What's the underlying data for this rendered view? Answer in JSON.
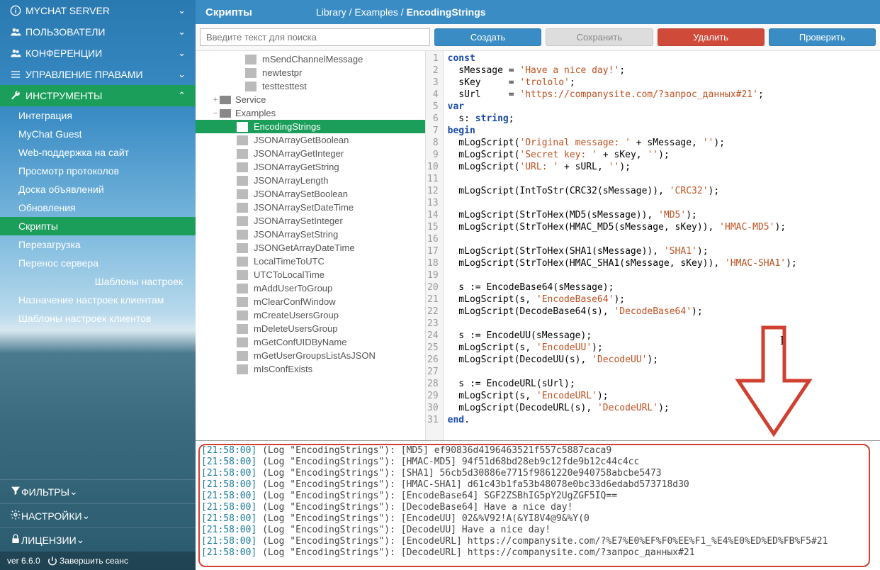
{
  "sidebar": {
    "top": [
      {
        "icon": "info",
        "label": "MYCHAT SERVER",
        "expand": "down"
      },
      {
        "icon": "users",
        "label": "ПОЛЬЗОВАТЕЛИ",
        "expand": "down"
      },
      {
        "icon": "users",
        "label": "КОНФЕРЕНЦИИ",
        "expand": "down"
      },
      {
        "icon": "list",
        "label": "УПРАВЛЕНИЕ ПРАВАМИ",
        "expand": "down"
      },
      {
        "icon": "wrench",
        "label": "ИНСТРУМЕНТЫ",
        "expand": "up"
      }
    ],
    "tools": [
      "Интеграция",
      "MyChat Guest",
      "Web-поддержка на сайт",
      "Просмотр протоколов",
      "Доска объявлений",
      "Обновления",
      "Скрипты",
      "Перезагрузка",
      "Перенос сервера"
    ],
    "tools_right": "Шаблоны настроек",
    "tools_more": [
      "Назначение настроек клиентам",
      "Шаблоны настроек клиентов"
    ],
    "bottom": [
      {
        "icon": "filter",
        "label": "ФИЛЬТРЫ"
      },
      {
        "icon": "gear",
        "label": "НАСТРОЙКИ"
      },
      {
        "icon": "lock",
        "label": "ЛИЦЕНЗИИ"
      }
    ],
    "version": "ver 6.6.0",
    "logout": "Завершить сеанс"
  },
  "topbar": {
    "title": "Скрипты",
    "crumb1": "Library",
    "crumb2": "Examples",
    "crumb3": "EncodingStrings"
  },
  "toolbar": {
    "search_ph": "Введите текст для поиска",
    "create": "Создать",
    "save": "Сохранить",
    "delete": "Удалить",
    "check": "Проверить"
  },
  "tree": {
    "top_files": [
      "mSendChannelMessage",
      "newtestpr",
      "testtesttest"
    ],
    "folders": [
      {
        "name": "Service",
        "exp": "+"
      },
      {
        "name": "Examples",
        "exp": "−"
      }
    ],
    "example_files": [
      "EncodingStrings",
      "JSONArrayGetBoolean",
      "JSONArrayGetInteger",
      "JSONArrayGetString",
      "JSONArrayLength",
      "JSONArraySetBoolean",
      "JSONArraySetDateTime",
      "JSONArraySetInteger",
      "JSONArraySetString",
      "JSONGetArrayDateTime",
      "LocalTimeToUTC",
      "UTCToLocalTime",
      "mAddUserToGroup",
      "mClearConfWindow",
      "mCreateUsersGroup",
      "mDeleteUsersGroup",
      "mGetConfUIDByName",
      "mGetUserGroupsListAsJSON",
      "mIsConfExists"
    ]
  },
  "code": {
    "l1a": "const",
    "l2a": "  sMessage = ",
    "l2b": "'Have a nice day!'",
    "l2c": ";",
    "l3a": "  sKey     = ",
    "l3b": "'trololo'",
    "l3c": ";",
    "l4a": "  sUrl     = ",
    "l4b": "'https://companysite.com/?запрос_данных#21'",
    "l4c": ";",
    "l5a": "var",
    "l6a": "  s: ",
    "l6b": "string",
    "l6c": ";",
    "l7a": "begin",
    "l8a": "  mLogScript(",
    "l8b": "'Original message: '",
    "l8c": " + sMessage, ",
    "l8d": "''",
    "l8e": ");",
    "l9a": "  mLogScript(",
    "l9b": "'Secret key: '",
    "l9c": " + sKey, ",
    "l9d": "''",
    "l9e": ");",
    "l10a": "  mLogScript(",
    "l10b": "'URL: '",
    "l10c": " + sURL, ",
    "l10d": "''",
    "l10e": ");",
    "l12a": "  mLogScript(IntToStr(CRC32(sMessage)), ",
    "l12b": "'CRC32'",
    "l12c": ");",
    "l14a": "  mLogScript(StrToHex(MD5(sMessage)), ",
    "l14b": "'MD5'",
    "l14c": ");",
    "l15a": "  mLogScript(StrToHex(HMAC_MD5(sMessage, sKey)), ",
    "l15b": "'HMAC-MD5'",
    "l15c": ");",
    "l17a": "  mLogScript(StrToHex(SHA1(sMessage)), ",
    "l17b": "'SHA1'",
    "l17c": ");",
    "l18a": "  mLogScript(StrToHex(HMAC_SHA1(sMessage, sKey)), ",
    "l18b": "'HMAC-SHA1'",
    "l18c": ");",
    "l20a": "  s := EncodeBase64(sMessage);",
    "l21a": "  mLogScript(s, ",
    "l21b": "'EncodeBase64'",
    "l21c": ");",
    "l22a": "  mLogScript(DecodeBase64(s), ",
    "l22b": "'DecodeBase64'",
    "l22c": ");",
    "l24a": "  s := EncodeUU(sMessage);",
    "l25a": "  mLogScript(s, ",
    "l25b": "'EncodeUU'",
    "l25c": ");",
    "l26a": "  mLogScript(DecodeUU(s), ",
    "l26b": "'DecodeUU'",
    "l26c": ");",
    "l28a": "  s := EncodeURL(sUrl);",
    "l29a": "  mLogScript(s, ",
    "l29b": "'EncodeURL'",
    "l29c": ");",
    "l30a": "  mLogScript(DecodeURL(s), ",
    "l30b": "'DecodeURL'",
    "l30c": ");",
    "l31a": "end",
    "l31b": "."
  },
  "log": [
    {
      "ts": "[21:58:00]",
      "body": " (Log \"EncodingStrings\"): [MD5] ef90836d4196463521f557c5887caca9"
    },
    {
      "ts": "[21:58:00]",
      "body": " (Log \"EncodingStrings\"): [HMAC-MD5] 94f51d68bd28eb9c12fde9b12c44c4cc"
    },
    {
      "ts": "[21:58:00]",
      "body": " (Log \"EncodingStrings\"): [SHA1] 56cb5d30886e7715f9861220e940758abcbe5473"
    },
    {
      "ts": "[21:58:00]",
      "body": " (Log \"EncodingStrings\"): [HMAC-SHA1] d61c43b1fa53b48078e0bc33d6edabd573718d30"
    },
    {
      "ts": "[21:58:00]",
      "body": " (Log \"EncodingStrings\"): [EncodeBase64] SGF2ZSBhIG5pY2UgZGF5IQ=="
    },
    {
      "ts": "[21:58:00]",
      "body": " (Log \"EncodingStrings\"): [DecodeBase64] Have a nice day!"
    },
    {
      "ts": "[21:58:00]",
      "body": " (Log \"EncodingStrings\"): [EncodeUU] 02&%V92!A(&YI8V4@9&%Y(0"
    },
    {
      "ts": "[21:58:00]",
      "body": " (Log \"EncodingStrings\"): [DecodeUU] Have a nice day!"
    },
    {
      "ts": "[21:58:00]",
      "body": " (Log \"EncodingStrings\"): [EncodeURL] https://companysite.com/?%E7%E0%EF%F0%EE%F1_%E4%E0%ED%ED%FB%F5#21"
    },
    {
      "ts": "[21:58:00]",
      "body": " (Log \"EncodingStrings\"): [DecodeURL] https://companysite.com/?запрос_данных#21"
    }
  ]
}
